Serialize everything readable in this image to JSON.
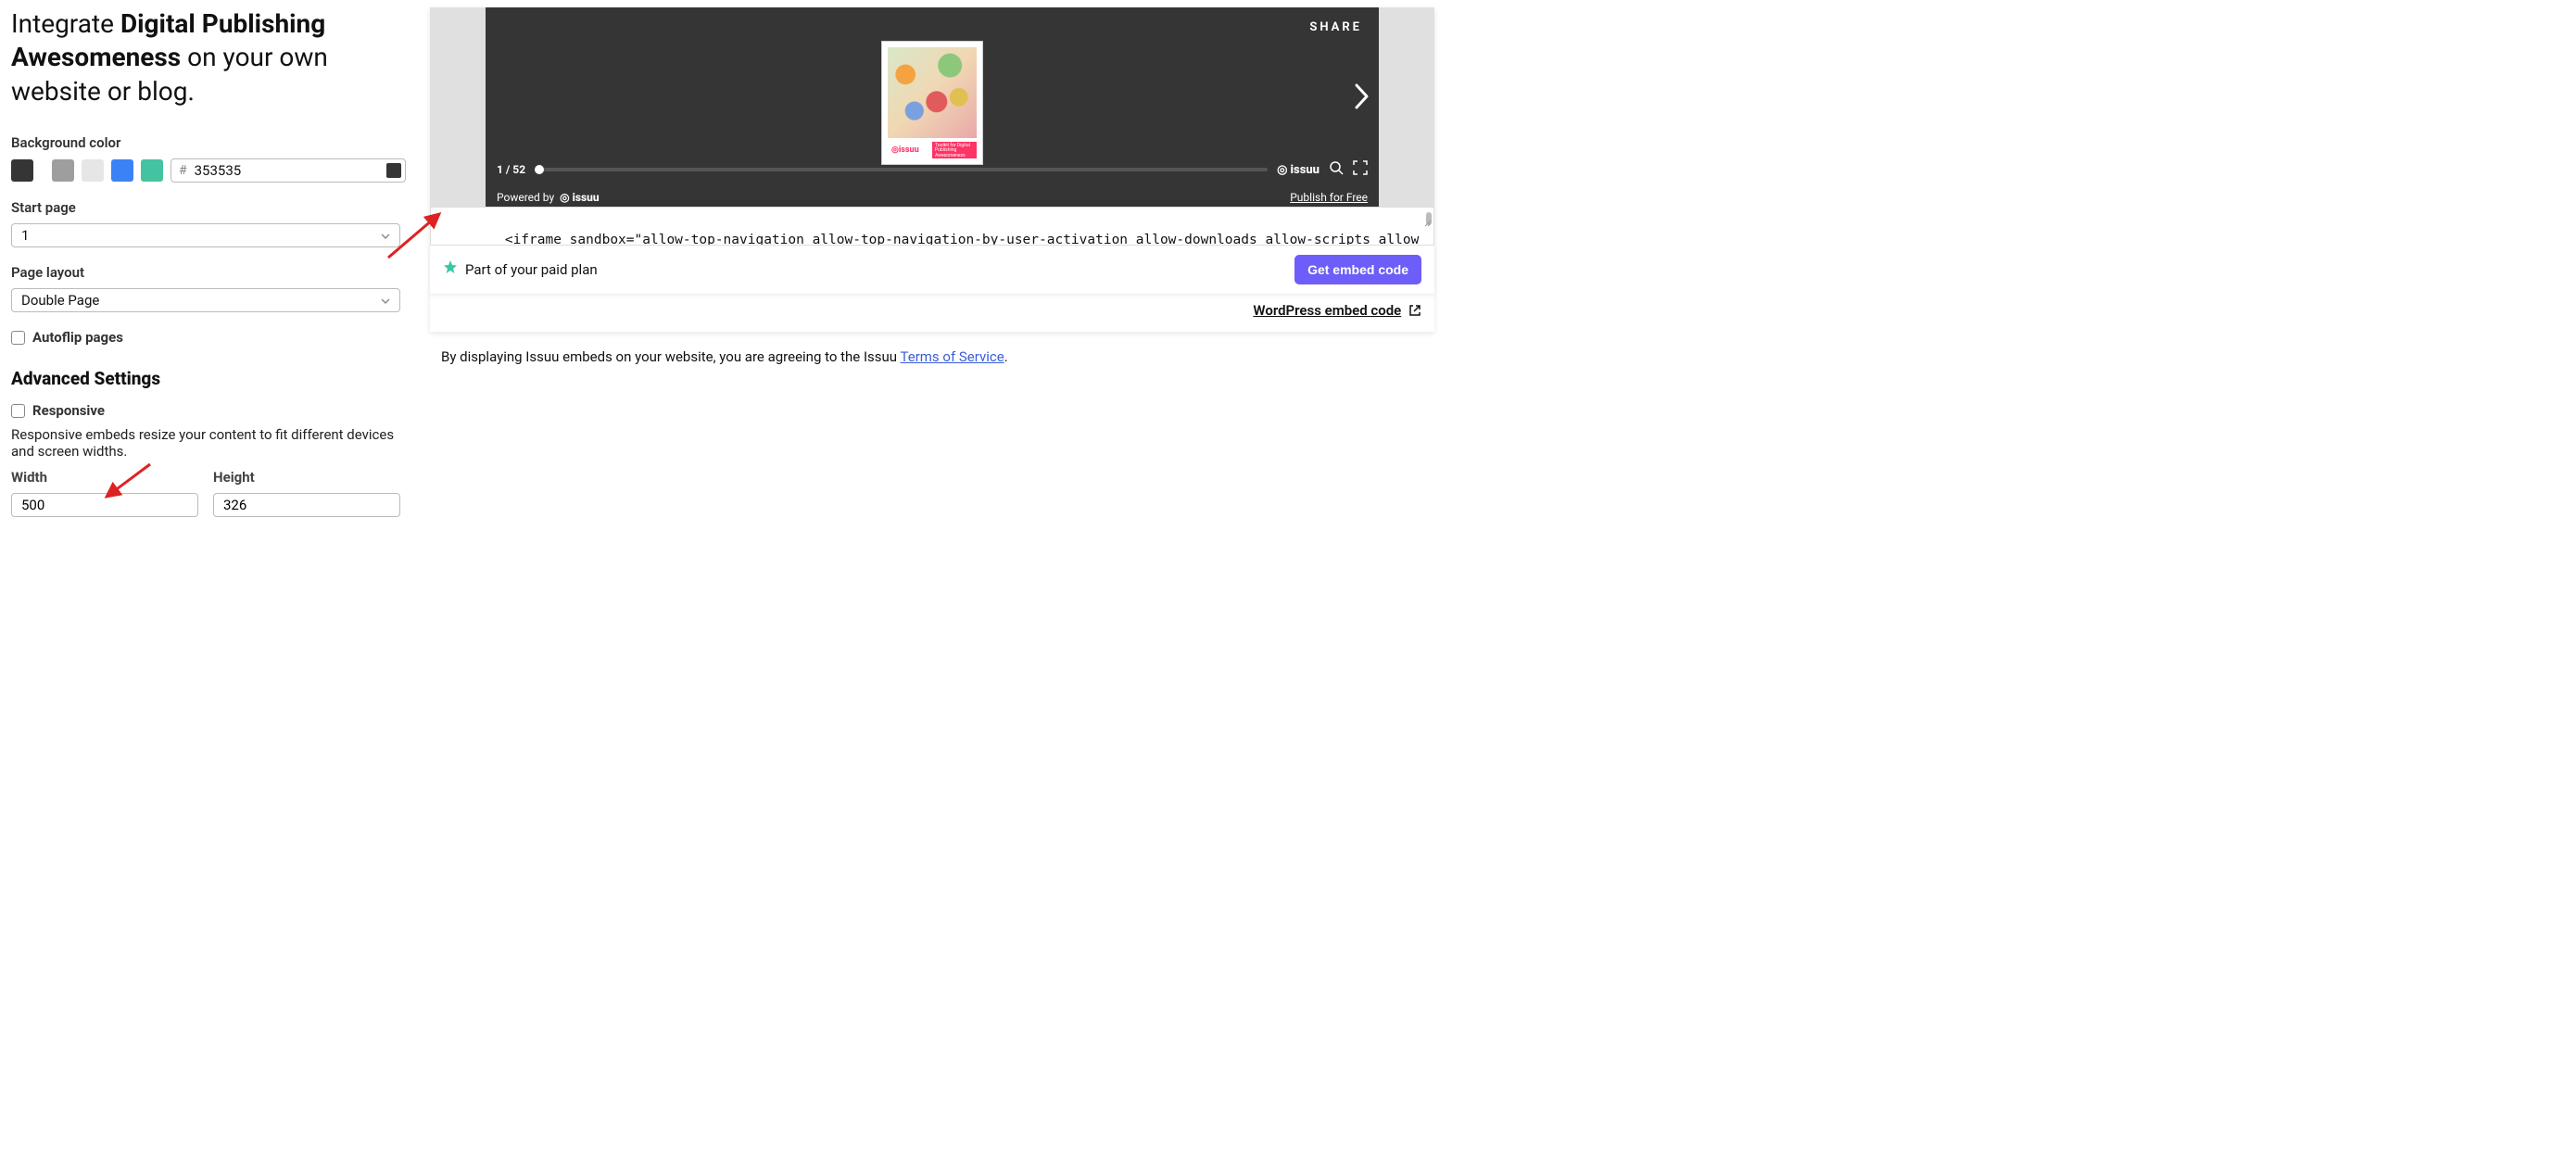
{
  "title": {
    "pre": "Integrate ",
    "bold": "Digital Publishing Awesomeness",
    "post": " on your own website or blog."
  },
  "bg_color": {
    "label": "Background color",
    "swatches": [
      "#353535",
      "#9e9e9e",
      "#e6e6e6",
      "#3b82f6",
      "#45c3a0"
    ],
    "hash": "#",
    "value": "353535"
  },
  "start_page": {
    "label": "Start page",
    "value": "1"
  },
  "page_layout": {
    "label": "Page layout",
    "value": "Double Page"
  },
  "autoflip": {
    "label": "Autoflip pages"
  },
  "advanced": {
    "header": "Advanced Settings",
    "responsive_label": "Responsive",
    "responsive_help": "Responsive embeds resize your content to fit different devices and screen widths.",
    "width_label": "Width",
    "width_value": "500",
    "height_label": "Height",
    "height_value": "326"
  },
  "preview": {
    "share": "SHARE",
    "cover_brand": "issuu",
    "cover_tag": "Toolkit for\nDigital Publishing\nAwesomeness",
    "page_indicator": "1 / 52",
    "brand_mark": "issuu",
    "powered_by": "Powered by",
    "powered_brand": "issuu",
    "publish_free": "Publish for Free"
  },
  "embed_code": "<iframe sandbox=\"allow-top-navigation allow-top-navigation-by-user-activation allow-downloads allow-scripts allow-same-origin allow-popups allow-modals allow-popups-to-escape-sandbox\" allowfullscreen=\"true\"",
  "plan_badge": "Part of your paid plan",
  "get_code_button": "Get embed code",
  "wordpress_link": "WordPress embed code",
  "footnote_pre": "By displaying Issuu embeds on your website, you are agreeing to the Issuu ",
  "footnote_link": "Terms of Service",
  "footnote_post": "."
}
